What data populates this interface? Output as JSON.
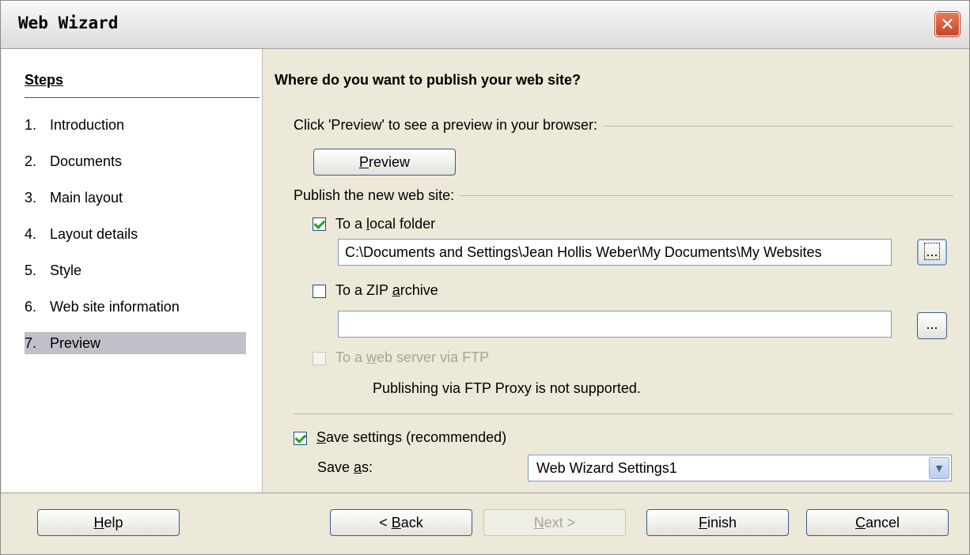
{
  "window": {
    "title": "Web Wizard",
    "close_icon": "close-icon"
  },
  "steps": {
    "title": "Steps",
    "items": [
      {
        "num": "1.",
        "label": "Introduction"
      },
      {
        "num": "2.",
        "label": "Documents"
      },
      {
        "num": "3.",
        "label": "Main layout"
      },
      {
        "num": "4.",
        "label": "Layout details"
      },
      {
        "num": "5.",
        "label": "Style"
      },
      {
        "num": "6.",
        "label": "Web site information"
      },
      {
        "num": "7.",
        "label": "Preview"
      }
    ],
    "active": "7. Preview"
  },
  "main": {
    "title": "Where do you want to publish your web site?",
    "preview_section": "Click 'Preview' to see a preview in your browser:",
    "preview_button": "Preview",
    "publish_section": "Publish the new web site:",
    "local_folder": {
      "label": "To a local folder",
      "checked": true,
      "path": "C:\\Documents and Settings\\Jean Hollis Weber\\My Documents\\My Websites",
      "browse": "..."
    },
    "zip_archive": {
      "label": "To a ZIP archive",
      "checked": false,
      "path": "",
      "browse": "..."
    },
    "ftp": {
      "label": "To a web server via FTP",
      "checked": false,
      "note": "Publishing via FTP Proxy is not supported."
    },
    "save_settings": {
      "label": "Save settings (recommended)",
      "checked": true,
      "save_as_label": "Save as:",
      "save_as_value": "Web Wizard Settings1"
    }
  },
  "footer": {
    "help": "Help",
    "back": "< Back",
    "next": "Next >",
    "finish": "Finish",
    "cancel": "Cancel"
  },
  "colors": {
    "checkmark": "#21a121",
    "active_step_bg": "#c0c0c8",
    "close_button": "#c8452b"
  }
}
